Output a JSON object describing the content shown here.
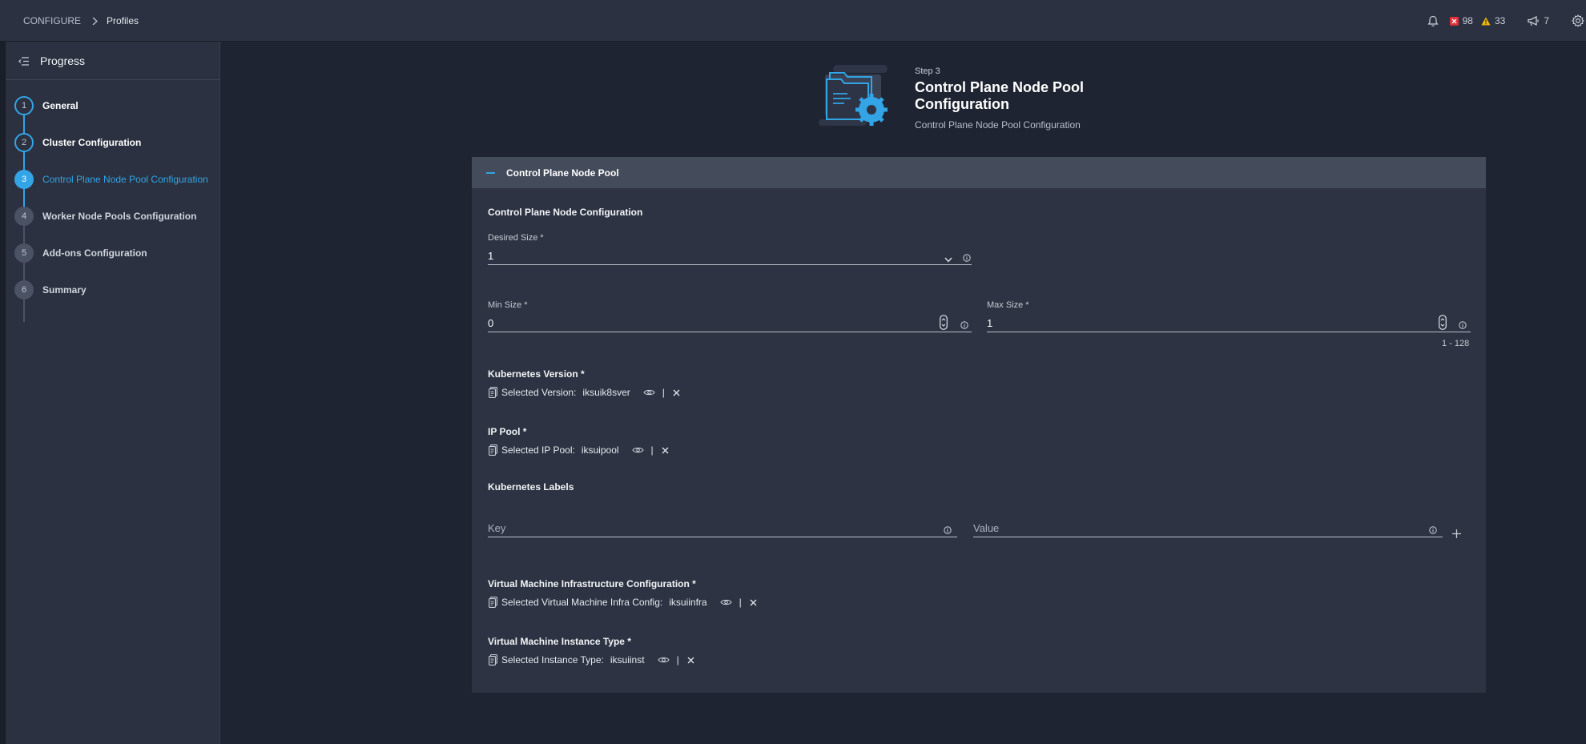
{
  "breadcrumb": {
    "root": "CONFIGURE",
    "current": "Profiles"
  },
  "topbar": {
    "critical_count": "98",
    "warning_count": "33",
    "announcements_count": "7",
    "colors": {
      "critical": "#e2303a",
      "warning": "#f5b800"
    }
  },
  "sidebar": {
    "title": "Progress",
    "steps": [
      {
        "num": "1",
        "label": "General",
        "state": "done"
      },
      {
        "num": "2",
        "label": "Cluster Configuration",
        "state": "done"
      },
      {
        "num": "3",
        "label": "Control Plane Node Pool Configuration",
        "state": "active"
      },
      {
        "num": "4",
        "label": "Worker Node Pools Configuration",
        "state": "todo"
      },
      {
        "num": "5",
        "label": "Add-ons Configuration",
        "state": "todo"
      },
      {
        "num": "6",
        "label": "Summary",
        "state": "todo"
      }
    ]
  },
  "header": {
    "kicker": "Step 3",
    "title": "Control Plane Node Pool Configuration",
    "subtitle": "Control Plane Node Pool Configuration"
  },
  "card": {
    "title": "Control Plane Node Pool",
    "node_config_title": "Control Plane Node Configuration",
    "desired_size": {
      "label": "Desired Size *",
      "value": "1"
    },
    "min_size": {
      "label": "Min Size *",
      "value": "0"
    },
    "max_size": {
      "label": "Max Size *",
      "value": "1",
      "hint": "1 - 128"
    },
    "k8s_version": {
      "title": "Kubernetes Version *",
      "prefix": "Selected Version:",
      "value": "iksuik8sver"
    },
    "ip_pool": {
      "title": "IP Pool *",
      "prefix": "Selected IP Pool:",
      "value": "iksuipool"
    },
    "labels": {
      "title": "Kubernetes Labels",
      "key_placeholder": "Key",
      "value_placeholder": "Value"
    },
    "vm_infra": {
      "title": "Virtual Machine Infrastructure Configuration *",
      "prefix": "Selected Virtual Machine Infra Config:",
      "value": "iksuiinfra"
    },
    "vm_instance": {
      "title": "Virtual Machine Instance Type *",
      "prefix": "Selected Instance Type:",
      "value": "iksuiinst"
    },
    "pipe": "|"
  },
  "accent_color": "#33a4e6"
}
